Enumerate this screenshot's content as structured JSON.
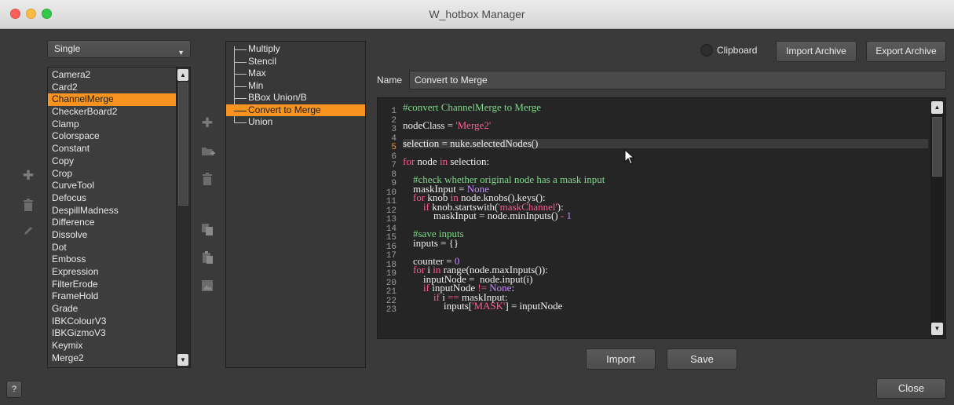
{
  "window": {
    "title": "W_hotbox Manager"
  },
  "mode_select": {
    "value": "Single"
  },
  "node_list": {
    "items": [
      "Camera2",
      "Card2",
      "ChannelMerge",
      "CheckerBoard2",
      "Clamp",
      "Colorspace",
      "Constant",
      "Copy",
      "Crop",
      "CurveTool",
      "Defocus",
      "DespillMadness",
      "Difference",
      "Dissolve",
      "Dot",
      "Emboss",
      "Expression",
      "FilterErode",
      "FrameHold",
      "Grade",
      "IBKColourV3",
      "IBKGizmoV3",
      "Keymix",
      "Merge2"
    ],
    "selected": "ChannelMerge"
  },
  "tree": {
    "items": [
      "Multiply",
      "Stencil",
      "Max",
      "Min",
      "BBox Union/B",
      "Convert to Merge",
      "Union"
    ],
    "selected": "Convert to Merge"
  },
  "top_controls": {
    "clipboard_label": "Clipboard",
    "import_archive": "Import Archive",
    "export_archive": "Export Archive"
  },
  "name": {
    "label": "Name",
    "value": "Convert to Merge"
  },
  "editor": {
    "current_line": 5,
    "lines": [
      [
        [
          "#convert ChannelMerge to Merge",
          "#7fd98a"
        ]
      ],
      [],
      [
        [
          "nodeClass = ",
          "#f0f0f0"
        ],
        [
          "'Merge2'",
          "#ff5c8d"
        ]
      ],
      [],
      [
        [
          "selection = nuke.selectedNodes()",
          "#f0f0f0"
        ]
      ],
      [],
      [
        [
          "for",
          "#ff5c8d"
        ],
        [
          " node ",
          "#f0f0f0"
        ],
        [
          "in",
          "#ff5c8d"
        ],
        [
          " selection:",
          "#f0f0f0"
        ]
      ],
      [],
      [
        [
          "    #check whether original node has a mask input",
          "#7fd98a"
        ]
      ],
      [
        [
          "    maskInput = ",
          "#f0f0f0"
        ],
        [
          "None",
          "#c78cff"
        ]
      ],
      [
        [
          "    ",
          "#f0f0f0"
        ],
        [
          "for",
          "#ff5c8d"
        ],
        [
          " knob ",
          "#f0f0f0"
        ],
        [
          "in",
          "#ff5c8d"
        ],
        [
          " node.knobs().keys():",
          "#f0f0f0"
        ]
      ],
      [
        [
          "        ",
          "#f0f0f0"
        ],
        [
          "if",
          "#ff5c8d"
        ],
        [
          " knob.startswith(",
          "#f0f0f0"
        ],
        [
          "'maskChannel'",
          "#ff5c8d"
        ],
        [
          "):",
          "#f0f0f0"
        ]
      ],
      [
        [
          "            maskInput = node.minInputs() ",
          "#f0f0f0"
        ],
        [
          "-",
          "#ff5c8d"
        ],
        [
          " ",
          "#f0f0f0"
        ],
        [
          "1",
          "#c78cff"
        ]
      ],
      [],
      [
        [
          "    #save inputs",
          "#7fd98a"
        ]
      ],
      [
        [
          "    inputs = {}",
          "#f0f0f0"
        ]
      ],
      [],
      [
        [
          "    counter = ",
          "#f0f0f0"
        ],
        [
          "0",
          "#c78cff"
        ]
      ],
      [
        [
          "    ",
          "#f0f0f0"
        ],
        [
          "for",
          "#ff5c8d"
        ],
        [
          " i ",
          "#f0f0f0"
        ],
        [
          "in",
          "#ff5c8d"
        ],
        [
          " range(node.maxInputs()):",
          "#f0f0f0"
        ]
      ],
      [
        [
          "        inputNode =  node.input(i)",
          "#f0f0f0"
        ]
      ],
      [
        [
          "        ",
          "#f0f0f0"
        ],
        [
          "if",
          "#ff5c8d"
        ],
        [
          " inputNode ",
          "#f0f0f0"
        ],
        [
          "!=",
          "#ff5c8d"
        ],
        [
          " ",
          "#f0f0f0"
        ],
        [
          "None",
          "#c78cff"
        ],
        [
          ":",
          "#f0f0f0"
        ]
      ],
      [
        [
          "            ",
          "#f0f0f0"
        ],
        [
          "if",
          "#ff5c8d"
        ],
        [
          " i ",
          "#f0f0f0"
        ],
        [
          "==",
          "#ff5c8d"
        ],
        [
          " maskInput:",
          "#f0f0f0"
        ]
      ],
      [
        [
          "                inputs[",
          "#f0f0f0"
        ],
        [
          "'MASK'",
          "#ff5c8d"
        ],
        [
          "] = inputNode",
          "#f0f0f0"
        ]
      ]
    ]
  },
  "buttons": {
    "import": "Import",
    "save": "Save",
    "close": "Close",
    "help": "?"
  },
  "colors": {
    "accent": "#f7931e",
    "background": "#3a3a3a",
    "editor_bg": "#252525"
  }
}
